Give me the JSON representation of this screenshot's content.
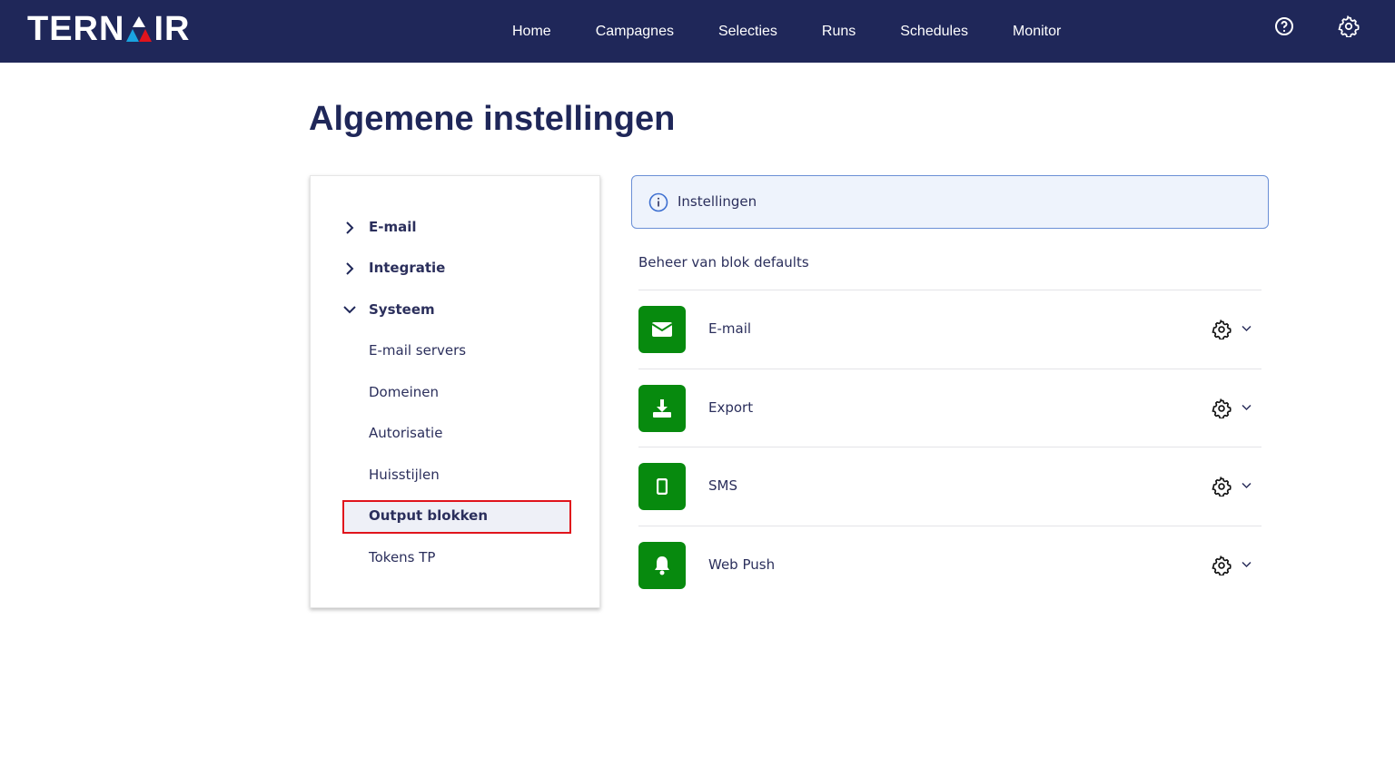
{
  "brand": {
    "logo_text": "TERNAIR",
    "logo_left": "TERN",
    "logo_right": "IR"
  },
  "nav": {
    "items": [
      "Home",
      "Campagnes",
      "Selecties",
      "Runs",
      "Schedules",
      "Monitor"
    ],
    "icons": [
      "help-icon",
      "settings-icon"
    ]
  },
  "page": {
    "title": "Algemene instellingen"
  },
  "sidebar": {
    "items": [
      {
        "label": "E-mail",
        "state": "collapsed"
      },
      {
        "label": "Integratie",
        "state": "collapsed"
      },
      {
        "label": "Systeem",
        "state": "expanded"
      },
      {
        "label": "E-mail servers"
      },
      {
        "label": "Domeinen"
      },
      {
        "label": "Autorisatie"
      },
      {
        "label": "Huisstijlen"
      },
      {
        "label": "Output blokken",
        "selected": true
      },
      {
        "label": "Tokens TP"
      }
    ]
  },
  "main": {
    "info_label": "Instellingen",
    "subtitle": "Beheer van blok defaults",
    "blocks": [
      {
        "label": "E-mail",
        "icon": "envelope-icon"
      },
      {
        "label": "Export",
        "icon": "download-icon"
      },
      {
        "label": "SMS",
        "icon": "mobile-icon"
      },
      {
        "label": "Web Push",
        "icon": "bell-icon"
      }
    ]
  },
  "colors": {
    "nav": "#1f2759",
    "accent_green": "#078a0e",
    "selected_border": "#e0141c"
  }
}
